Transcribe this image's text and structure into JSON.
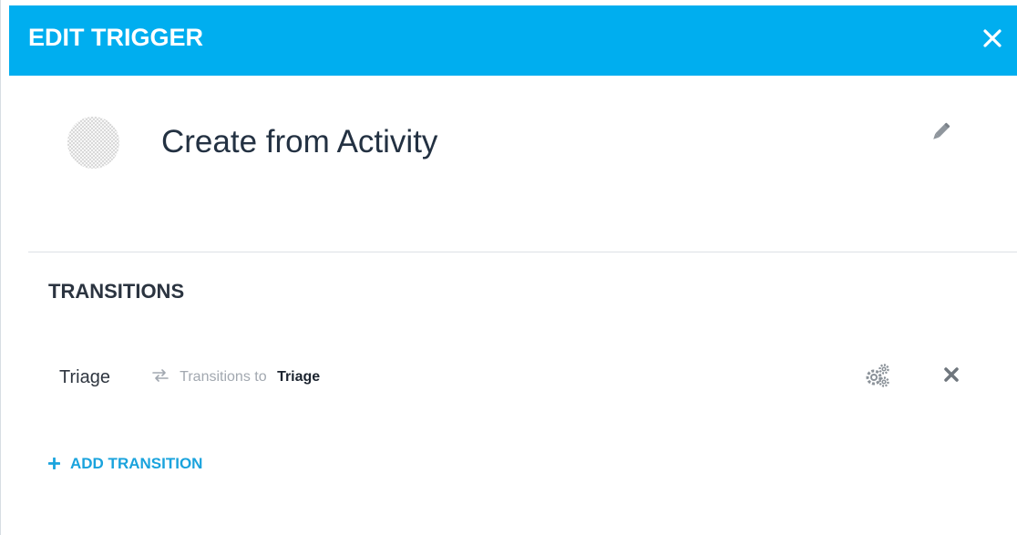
{
  "dialog": {
    "title": "EDIT TRIGGER",
    "close_icon": "close-icon"
  },
  "trigger": {
    "name": "Create from Activity",
    "avatar_icon": "placeholder-avatar",
    "edit_icon": "pencil-icon"
  },
  "transitions": {
    "title": "TRANSITIONS",
    "items": [
      {
        "name": "Triage",
        "transition_text": "Transitions to",
        "target": "Triage",
        "transition_icon": "swap-arrows-icon",
        "settings_icon": "gears-icon",
        "delete_icon": "delete-x-icon"
      }
    ],
    "add_label": "ADD TRANSITION",
    "add_icon": "plus-icon"
  },
  "colors": {
    "header": "#00aeef",
    "accent": "#1aa3dd",
    "text_dark": "#233142",
    "muted": "#a2a8b0"
  }
}
